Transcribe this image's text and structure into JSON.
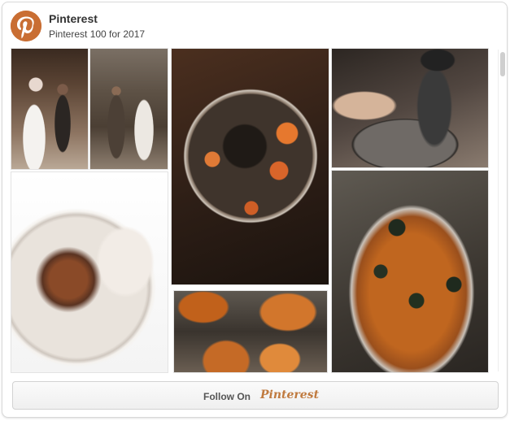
{
  "board": {
    "owner_name": "Pinterest",
    "board_title": "Pinterest 100 for 2017"
  },
  "pins": [
    {
      "name": "wedding-photo-left"
    },
    {
      "name": "wedding-photo-right"
    },
    {
      "name": "sweet-potato-salad-photo"
    },
    {
      "name": "sous-vide-photo"
    },
    {
      "name": "octopus-bowl-photo"
    },
    {
      "name": "nachos-photo"
    },
    {
      "name": "sweet-potato-chips-photo"
    }
  ],
  "footer": {
    "follow_label": "Follow On",
    "logo_text": "Pinterest"
  },
  "colors": {
    "brand": "#c96e33",
    "logo": "#c07a3f"
  },
  "icons": {
    "avatar": "pinterest-p-icon",
    "follow_logo": "pinterest-wordmark"
  }
}
